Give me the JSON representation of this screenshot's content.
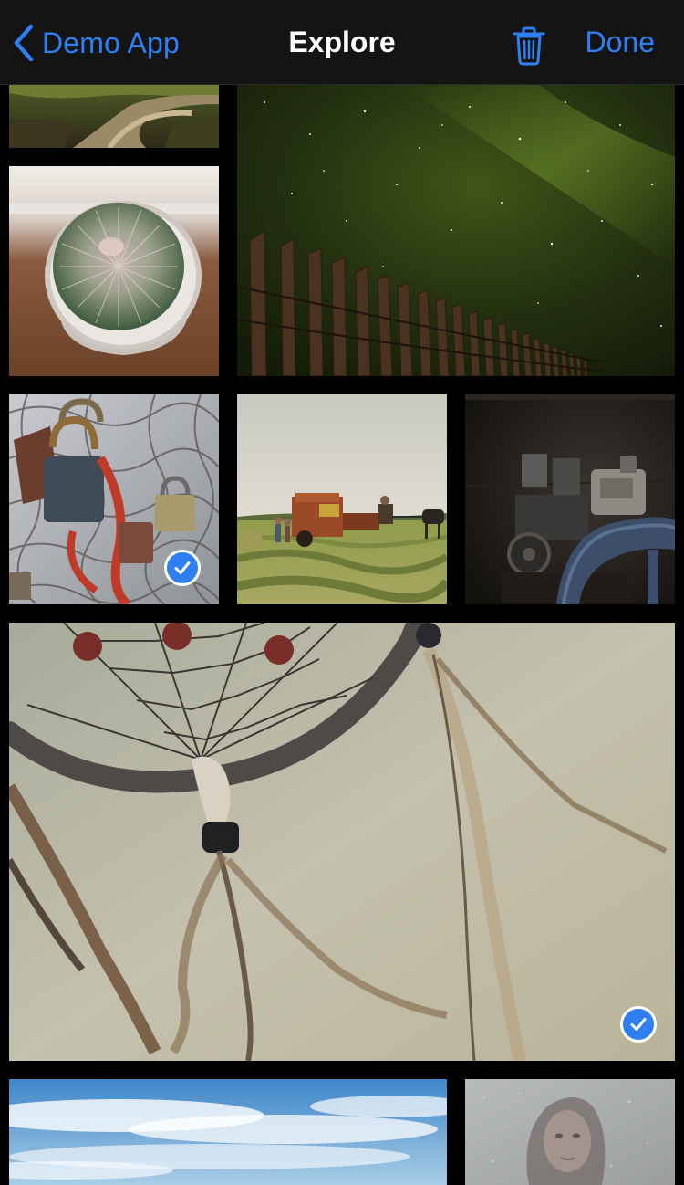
{
  "colors": {
    "accent": "#2f7ff2",
    "nav_background": "#141414",
    "title": "#ffffff"
  },
  "nav": {
    "back_label": "Demo App",
    "back_icon": "chevron-left-icon",
    "title": "Explore",
    "trash_icon": "trash-icon",
    "done_label": "Done"
  },
  "photos": [
    {
      "id": "forest-path",
      "subject": "dirt path through forest",
      "selected": false
    },
    {
      "id": "cactus",
      "subject": "round cactus in pot",
      "selected": false
    },
    {
      "id": "starry-fence",
      "subject": "wooden fence under starry night sky",
      "selected": false
    },
    {
      "id": "padlocks",
      "subject": "love padlocks on wire fence",
      "selected": true
    },
    {
      "id": "hay-baler",
      "subject": "horse-drawn hay baler in field",
      "selected": false
    },
    {
      "id": "old-machinery",
      "subject": "old machinery in dark room",
      "selected": false
    },
    {
      "id": "dreamcatcher",
      "subject": "dreamcatcher with feathers",
      "selected": true
    },
    {
      "id": "sky-clouds",
      "subject": "blue sky with clouds",
      "selected": false
    },
    {
      "id": "woman-fog",
      "subject": "woman behind misty glass",
      "selected": false
    }
  ]
}
